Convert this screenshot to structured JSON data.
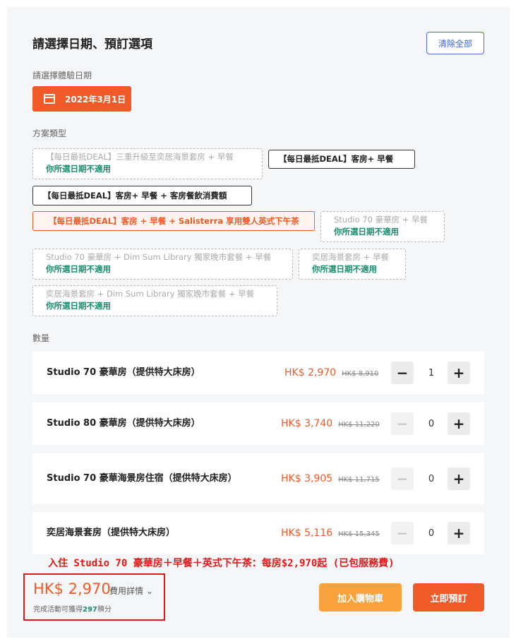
{
  "header": {
    "title": "請選擇日期、預訂選項",
    "clear_label": "清除全部"
  },
  "date_section": {
    "label": "請選擇體驗日期",
    "selected_date": "2022年3月1日"
  },
  "package_section": {
    "label": "方案類型",
    "not_applicable_text": "你所選日期不適用",
    "options": [
      {
        "label": "【每日最抵DEAL】三重升級至奕居海景套房 + 早餐",
        "state": "disabled"
      },
      {
        "label": "【每日最抵DEAL】客房+ 早餐",
        "state": "enabled"
      },
      {
        "label": "【每日最抵DEAL】客房+ 早餐 + 客房餐飲消費額",
        "state": "enabled"
      },
      {
        "label": "【每日最抵DEAL】客房 + 早餐 + Salisterra 享用雙人英式下午茶",
        "state": "selected"
      },
      {
        "label": "Studio 70 豪華房 + 早餐",
        "state": "disabled"
      },
      {
        "label": "Studio 70 豪華房 + Dim Sum Library 獨家晚市套餐 + 早餐",
        "state": "disabled"
      },
      {
        "label": "奕居海景套房 + 早餐",
        "state": "disabled"
      },
      {
        "label": "奕居海景套房 + Dim Sum Library 獨家晚市套餐 + 早餐",
        "state": "disabled"
      }
    ]
  },
  "quantity_section": {
    "label": "數量",
    "rooms": [
      {
        "name": "Studio 70 豪華房（提供特大床房）",
        "price": "HK$ 2,970",
        "original_price": "HK$ 8,910",
        "quantity": "1"
      },
      {
        "name": "Studio 80 豪華房（提供特大床房）",
        "price": "HK$ 3,740",
        "original_price": "HK$ 11,220",
        "quantity": "0"
      },
      {
        "name": "Studio 70 豪華海景房住宿（提供特大床房）",
        "price": "HK$ 3,905",
        "original_price": "HK$ 11,715",
        "quantity": "0"
      },
      {
        "name": "奕居海景套房（提供特大床房）",
        "price": "HK$ 5,116",
        "original_price": "HK$ 15,345",
        "quantity": "0"
      }
    ]
  },
  "promo_note": "入住 Studio 70 豪華房＋早餐＋英式下午茶：每房$2,970起 (已包服務費)",
  "footer": {
    "total_price": "HK$ 2,970",
    "details_label": "費用詳情",
    "points_prefix": "完成活動可獲得",
    "points_value": "297",
    "points_suffix": "積分",
    "cart_label": "加入購物車",
    "book_label": "立即預訂"
  },
  "colors": {
    "accent": "#f05a28",
    "cart": "#f9a23b",
    "link": "#3a63d0",
    "not_applicable": "#1a8c6e",
    "highlight": "#e01818"
  }
}
